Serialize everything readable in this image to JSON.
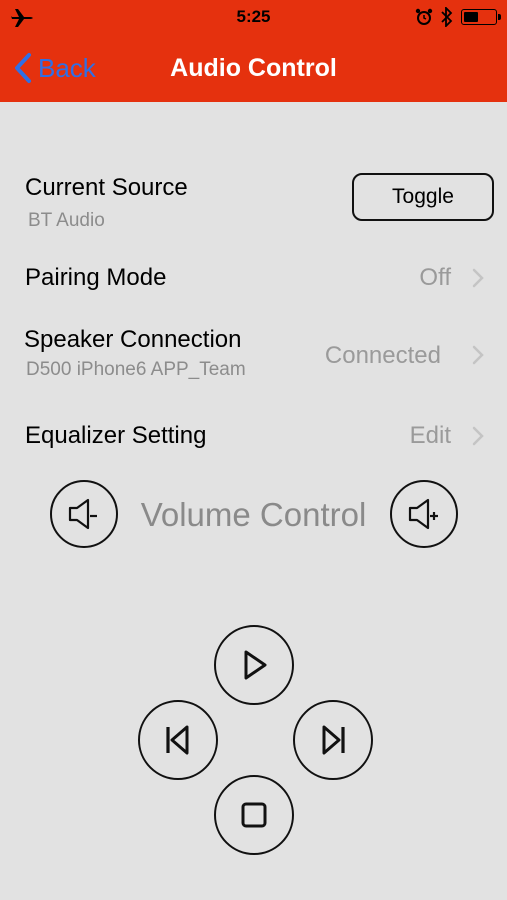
{
  "status_bar": {
    "time": "5:25",
    "battery_level": 0.45
  },
  "nav": {
    "back_label": "Back",
    "title": "Audio Control"
  },
  "current_source": {
    "title": "Current Source",
    "value": "BT Audio",
    "toggle_label": "Toggle"
  },
  "pairing_mode": {
    "title": "Pairing Mode",
    "value": "Off"
  },
  "speaker_connection": {
    "title": "Speaker Connection",
    "subtitle": "D500 iPhone6 APP_Team",
    "value": "Connected"
  },
  "equalizer": {
    "title": "Equalizer Setting",
    "value": "Edit"
  },
  "volume": {
    "label": "Volume Control"
  },
  "colors": {
    "nav_bar": "#e5310e",
    "back_link": "#2f6fe6",
    "background": "#e2e2e2",
    "secondary_text": "#9a9a9a"
  },
  "icons": [
    "airplane-icon",
    "alarm-icon",
    "bluetooth-icon",
    "battery-icon",
    "chevron-left-icon",
    "chevron-right-icon",
    "volume-down-icon",
    "volume-up-icon",
    "play-icon",
    "previous-track-icon",
    "next-track-icon",
    "stop-icon"
  ]
}
